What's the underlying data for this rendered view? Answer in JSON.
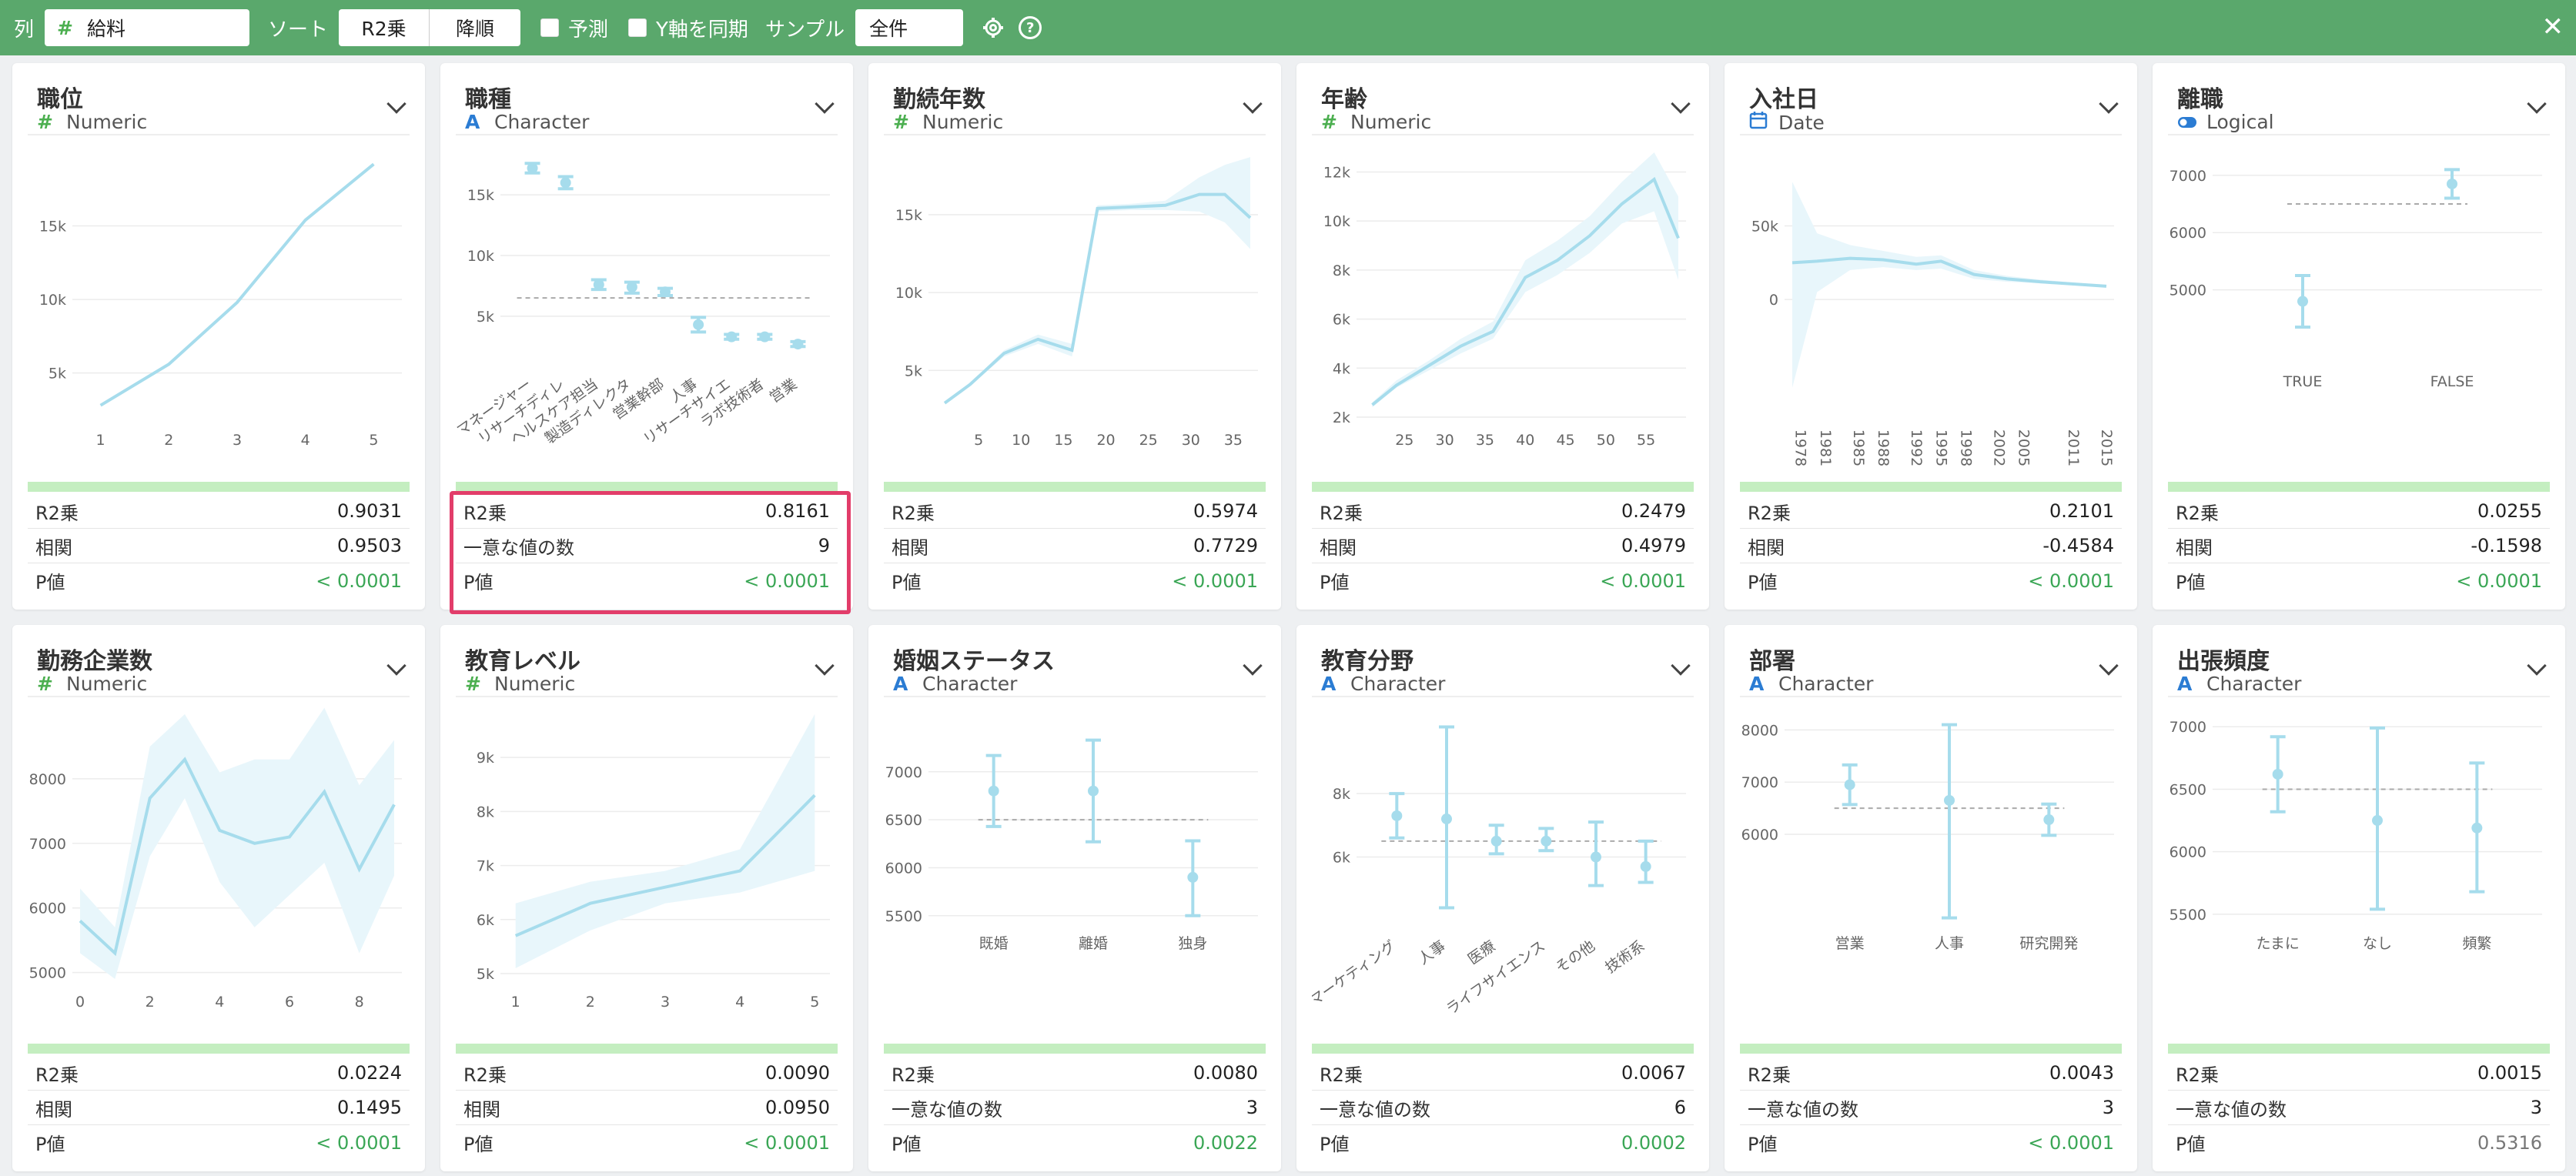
{
  "toolbar": {
    "column_label": "列",
    "column_icon": "hash-icon",
    "column_value": "給料",
    "sort_label": "ソート",
    "sort_field": "R2乗",
    "sort_order": "降順",
    "predict_label": "予測",
    "sync_y_label": "Y軸を同期",
    "sample_label": "サンプル",
    "sample_value": "全件",
    "close_icon": "close-icon",
    "settings_icon": "gear-icon",
    "help_icon": "help-icon",
    "help_glyph": "?",
    "close_glyph": "✕"
  },
  "colors": {
    "header_green": "#5aa86c",
    "line": "#a6dcec",
    "band": "#e8f6fb",
    "pvalue_green": "#3aa655",
    "numeric_icon": "#4caf50",
    "character_icon": "#2b7cd3",
    "highlight_border": "#e23d6a"
  },
  "stat_labels": {
    "r2": "R2乗",
    "corr": "相関",
    "unique": "一意な値の数",
    "p": "P値"
  },
  "cards": [
    {
      "title": "職位",
      "type": "Numeric",
      "type_icon": "#",
      "stats": {
        "r2": "0.9031",
        "second_label": "相関",
        "second": "0.9503",
        "p": "< 0.0001"
      },
      "chart_data": {
        "type": "line",
        "x": [
          1,
          2,
          3,
          4,
          5
        ],
        "y": [
          2800,
          5600,
          9800,
          15400,
          19200
        ],
        "lower": [
          2800,
          5600,
          9800,
          15400,
          19200
        ],
        "upper": [
          2800,
          5600,
          9800,
          15400,
          19200
        ],
        "xlim": [
          0.7,
          5.3
        ],
        "ylim": [
          2000,
          20000
        ],
        "yticks": [
          5000,
          10000,
          15000
        ],
        "ytick_labels": [
          "5k",
          "10k",
          "15k"
        ],
        "xticks": [
          1,
          2,
          3,
          4,
          5
        ],
        "xtick_labels": [
          "1",
          "2",
          "3",
          "4",
          "5"
        ]
      }
    },
    {
      "title": "職種",
      "type": "Character",
      "type_icon": "A",
      "stats": {
        "r2": "0.8161",
        "second_label": "一意な値の数",
        "second": "9",
        "p": "< 0.0001"
      },
      "chart_data": {
        "type": "errorbar",
        "categories": [
          "マネージャー",
          "リサーチディレクター",
          "ヘルスケア担当",
          "製造ディレクター",
          "営業幹部",
          "人事",
          "リサーチサイエンティスト",
          "ラボ技術者",
          "営業担当"
        ],
        "x_labels_shown": [
          "マネージャー",
          "リサーチディレ",
          "ヘルスケア担当",
          "製造ディレクタ",
          "営業幹部",
          "人事",
          "リサーチサイエ",
          "ラボ技術者",
          "営業"
        ],
        "values": [
          17200,
          16000,
          7600,
          7400,
          7000,
          4300,
          3300,
          3300,
          2700
        ],
        "lower": [
          16800,
          15500,
          7200,
          6900,
          6700,
          3700,
          3100,
          3100,
          2500
        ],
        "upper": [
          17600,
          16500,
          8000,
          7800,
          7300,
          4900,
          3500,
          3500,
          2900
        ],
        "mean_line": 6500,
        "ylim": [
          1500,
          18500
        ],
        "yticks": [
          5000,
          10000,
          15000
        ],
        "ytick_labels": [
          "5k",
          "10k",
          "15k"
        ]
      }
    },
    {
      "title": "勤続年数",
      "type": "Numeric",
      "type_icon": "#",
      "stats": {
        "r2": "0.5974",
        "second_label": "相関",
        "second": "0.7729",
        "p": "< 0.0001"
      },
      "chart_data": {
        "type": "line",
        "x": [
          1,
          4,
          8,
          12,
          16,
          19,
          23,
          27,
          31,
          34,
          37
        ],
        "y": [
          2900,
          4100,
          6100,
          7000,
          6300,
          15400,
          15500,
          15600,
          16300,
          16300,
          14800
        ],
        "lower": [
          2900,
          4000,
          5900,
          6700,
          5900,
          15200,
          15300,
          15300,
          15200,
          14500,
          12800
        ],
        "upper": [
          2900,
          4200,
          6300,
          7300,
          6700,
          15600,
          15700,
          15900,
          17400,
          18200,
          18700
        ],
        "xlim": [
          0,
          37
        ],
        "ylim": [
          2000,
          19000
        ],
        "yticks": [
          5000,
          10000,
          15000
        ],
        "ytick_labels": [
          "5k",
          "10k",
          "15k"
        ],
        "xticks": [
          5,
          10,
          15,
          20,
          25,
          30,
          35
        ],
        "xtick_labels": [
          "5",
          "10",
          "15",
          "20",
          "25",
          "30",
          "35"
        ]
      }
    },
    {
      "title": "年齢",
      "type": "Numeric",
      "type_icon": "#",
      "stats": {
        "r2": "0.2479",
        "second_label": "相関",
        "second": "0.4979",
        "p": "< 0.0001"
      },
      "chart_data": {
        "type": "line",
        "x": [
          21,
          24,
          28,
          32,
          36,
          40,
          44,
          48,
          52,
          56,
          59
        ],
        "y": [
          2500,
          3300,
          4100,
          4900,
          5500,
          7700,
          8400,
          9400,
          10700,
          11700,
          9300
        ],
        "lower": [
          2400,
          3200,
          3900,
          4600,
          5200,
          7100,
          7800,
          8700,
          9900,
          10400,
          7600
        ],
        "upper": [
          2600,
          3500,
          4300,
          5200,
          5900,
          8400,
          9200,
          10200,
          11600,
          12800,
          11000
        ],
        "xlim": [
          20,
          59
        ],
        "ylim": [
          2000,
          12800
        ],
        "yticks": [
          2000,
          4000,
          6000,
          8000,
          10000,
          12000
        ],
        "ytick_labels": [
          "2k",
          "4k",
          "6k",
          "8k",
          "10k",
          "12k"
        ],
        "xticks": [
          25,
          30,
          35,
          40,
          45,
          50,
          55
        ],
        "xtick_labels": [
          "25",
          "30",
          "35",
          "40",
          "45",
          "50",
          "55"
        ]
      }
    },
    {
      "title": "入社日",
      "type": "Date",
      "type_icon": "calendar-icon",
      "stats": {
        "r2": "0.2101",
        "second_label": "相関",
        "second": "-0.4584",
        "p": "< 0.0001"
      },
      "chart_data": {
        "type": "line",
        "x": [
          1977,
          1980,
          1984,
          1988,
          1992,
          1995,
          1999,
          2003,
          2007,
          2011,
          2015
        ],
        "y": [
          25000,
          26000,
          28000,
          27000,
          24000,
          26000,
          17000,
          14000,
          12000,
          10500,
          9000
        ],
        "lower": [
          -60000,
          5000,
          20000,
          22000,
          20000,
          21000,
          14000,
          12000,
          11000,
          10000,
          9000
        ],
        "upper": [
          80000,
          45000,
          37000,
          33000,
          29000,
          30000,
          20000,
          16000,
          13500,
          11500,
          9500
        ],
        "xlim": [
          1977,
          2015
        ],
        "ylim": [
          -80000,
          100000
        ],
        "yticks": [
          0,
          50000
        ],
        "ytick_labels": [
          "0",
          "50k"
        ],
        "xticks": [
          1978,
          1981,
          1985,
          1988,
          1992,
          1995,
          1998,
          2002,
          2005,
          2011,
          2015
        ],
        "xtick_labels": [
          "1978",
          "1981",
          "1985",
          "1988",
          "1992",
          "1995",
          "1998",
          "2002",
          "2005",
          "2011",
          "2015"
        ]
      }
    },
    {
      "title": "離職",
      "type": "Logical",
      "type_icon": "toggle-icon",
      "stats": {
        "r2": "0.0255",
        "second_label": "相関",
        "second": "-0.1598",
        "p": "< 0.0001"
      },
      "chart_data": {
        "type": "errorbar",
        "categories": [
          "TRUE",
          "FALSE"
        ],
        "x_labels_shown": [
          "TRUE",
          "FALSE"
        ],
        "values": [
          4800,
          6850
        ],
        "lower": [
          4350,
          6600
        ],
        "upper": [
          5250,
          7100
        ],
        "mean_line": 6500,
        "ylim": [
          3800,
          7400
        ],
        "yticks": [
          5000,
          6000,
          7000
        ],
        "ytick_labels": [
          "5000",
          "6000",
          "7000"
        ]
      }
    },
    {
      "title": "勤務企業数",
      "type": "Numeric",
      "type_icon": "#",
      "stats": {
        "r2": "0.0224",
        "second_label": "相関",
        "second": "0.1495",
        "p": "< 0.0001"
      },
      "chart_data": {
        "type": "line",
        "x": [
          0,
          1,
          2,
          3,
          4,
          5,
          6,
          7,
          8,
          9
        ],
        "y": [
          5800,
          5300,
          7700,
          8300,
          7200,
          7000,
          7100,
          7800,
          6600,
          7600
        ],
        "lower": [
          5300,
          4900,
          6800,
          7700,
          6400,
          5700,
          6200,
          6700,
          5300,
          6500
        ],
        "upper": [
          6300,
          5700,
          8500,
          9000,
          8100,
          8300,
          8300,
          9100,
          7900,
          8600
        ],
        "xlim": [
          0,
          9
        ],
        "ylim": [
          4900,
          9000
        ],
        "yticks": [
          5000,
          6000,
          7000,
          8000
        ],
        "ytick_labels": [
          "5000",
          "6000",
          "7000",
          "8000"
        ],
        "xticks": [
          0,
          2,
          4,
          6,
          8
        ],
        "xtick_labels": [
          "0",
          "2",
          "4",
          "6",
          "8"
        ]
      }
    },
    {
      "title": "教育レベル",
      "type": "Numeric",
      "type_icon": "#",
      "stats": {
        "r2": "0.0090",
        "second_label": "相関",
        "second": "0.0950",
        "p": "< 0.0001"
      },
      "chart_data": {
        "type": "line",
        "x": [
          1,
          2,
          3,
          4,
          5
        ],
        "y": [
          5700,
          6300,
          6600,
          6900,
          8300
        ],
        "lower": [
          5100,
          5800,
          6300,
          6500,
          6900
        ],
        "upper": [
          6300,
          6700,
          6900,
          7300,
          9800
        ],
        "xlim": [
          0.9,
          5.1
        ],
        "ylim": [
          4900,
          9800
        ],
        "yticks": [
          5000,
          6000,
          7000,
          8000,
          9000
        ],
        "ytick_labels": [
          "5k",
          "6k",
          "7k",
          "8k",
          "9k"
        ],
        "xticks": [
          1,
          2,
          3,
          4,
          5
        ],
        "xtick_labels": [
          "1",
          "2",
          "3",
          "4",
          "5"
        ]
      }
    },
    {
      "title": "婚姻ステータス",
      "type": "Character",
      "type_icon": "A",
      "stats": {
        "r2": "0.0080",
        "second_label": "一意な値の数",
        "second": "3",
        "p": "0.0022"
      },
      "chart_data": {
        "type": "errorbar",
        "categories": [
          "既婚",
          "離婚",
          "独身"
        ],
        "x_labels_shown": [
          "既婚",
          "離婚",
          "独身"
        ],
        "values": [
          6800,
          6800,
          5900
        ],
        "lower": [
          6430,
          6270,
          5500
        ],
        "upper": [
          7170,
          7330,
          6280
        ],
        "mean_line": 6500,
        "ylim": [
          5450,
          7600
        ],
        "yticks": [
          5500,
          6000,
          6500,
          7000
        ],
        "ytick_labels": [
          "5500",
          "6000",
          "6500",
          "7000"
        ]
      }
    },
    {
      "title": "教育分野",
      "type": "Character",
      "type_icon": "A",
      "stats": {
        "r2": "0.0067",
        "second_label": "一意な値の数",
        "second": "6",
        "p": "0.0002"
      },
      "chart_data": {
        "type": "errorbar",
        "categories": [
          "マーケティング",
          "人事",
          "医療",
          "ライフサイエンス",
          "その他",
          "技術系"
        ],
        "x_labels_shown": [
          "マーケティング",
          "人事",
          "医療",
          "ライフサイエンス",
          "その他",
          "技術系"
        ],
        "values": [
          7300,
          7200,
          6500,
          6500,
          6000,
          5700
        ],
        "lower": [
          6600,
          4400,
          6100,
          6200,
          5100,
          5200
        ],
        "upper": [
          8000,
          10100,
          7000,
          6900,
          7100,
          6500
        ],
        "mean_line": 6500,
        "ylim": [
          4000,
          10500
        ],
        "yticks": [
          6000,
          8000
        ],
        "ytick_labels": [
          "6k",
          "8k"
        ]
      }
    },
    {
      "title": "部署",
      "type": "Character",
      "type_icon": "A",
      "stats": {
        "r2": "0.0043",
        "second_label": "一意な値の数",
        "second": "3",
        "p": "< 0.0001"
      },
      "chart_data": {
        "type": "errorbar",
        "categories": [
          "営業",
          "人事",
          "研究開発"
        ],
        "x_labels_shown": [
          "営業",
          "人事",
          "研究開発"
        ],
        "values": [
          6950,
          6650,
          6280
        ],
        "lower": [
          6570,
          4400,
          5980
        ],
        "upper": [
          7330,
          8100,
          6580
        ],
        "mean_line": 6500,
        "ylim": [
          4350,
          8300
        ],
        "yticks": [
          6000,
          7000,
          8000
        ],
        "ytick_labels": [
          "6000",
          "7000",
          "8000"
        ]
      }
    },
    {
      "title": "出張頻度",
      "type": "Character",
      "type_icon": "A",
      "stats": {
        "r2": "0.0015",
        "second_label": "一意な値の数",
        "second": "3",
        "p": "0.5316"
      },
      "chart_data": {
        "type": "errorbar",
        "categories": [
          "たまに",
          "なし",
          "頻繁"
        ],
        "x_labels_shown": [
          "たまに",
          "なし",
          "頻繁"
        ],
        "values": [
          6620,
          6250,
          6190
        ],
        "lower": [
          6320,
          5540,
          5680
        ],
        "upper": [
          6920,
          6990,
          6710
        ],
        "mean_line": 6500,
        "ylim": [
          5450,
          7100
        ],
        "yticks": [
          5500,
          6000,
          6500,
          7000
        ],
        "ytick_labels": [
          "5500",
          "6000",
          "6500",
          "7000"
        ]
      }
    }
  ]
}
